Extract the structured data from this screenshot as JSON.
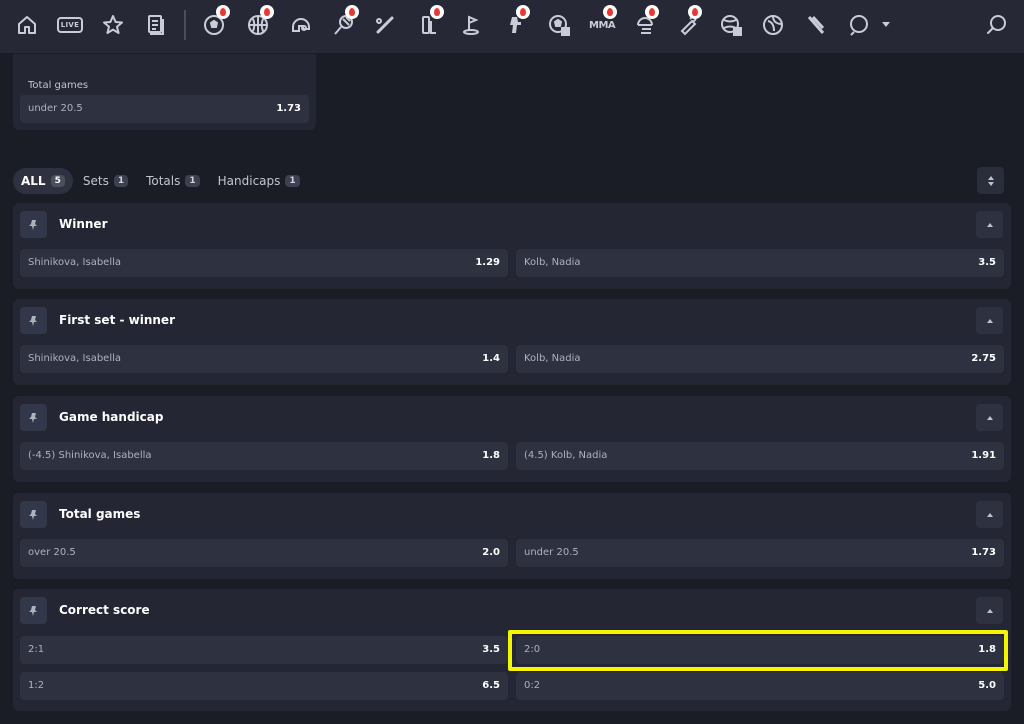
{
  "topbar": {
    "icons": [
      "home-icon",
      "live-icon",
      "star-icon",
      "betslip-icon",
      "soccer-icon",
      "basketball-icon",
      "hockey-icon",
      "tennis-icon",
      "baseball-icon",
      "cricket-icon",
      "golf-icon",
      "esports-icon",
      "futsal-icon",
      "mma-icon",
      "table-tennis-icon",
      "boxing-icon",
      "handball-icon",
      "rugby-icon",
      "badminton-icon",
      "volleyball-icon",
      "search-icon"
    ],
    "live_label": "LIVE",
    "mma_label": "MMA"
  },
  "previous_market": {
    "title": "Total games",
    "odds": [
      {
        "label": "under 20.5",
        "value": "1.73"
      }
    ]
  },
  "filter_tabs": [
    {
      "label": "ALL",
      "count": "5"
    },
    {
      "label": "Sets",
      "count": "1"
    },
    {
      "label": "Totals",
      "count": "1"
    },
    {
      "label": "Handicaps",
      "count": "1"
    }
  ],
  "markets": [
    {
      "title": "Winner",
      "odds": [
        {
          "label": "Shinikova, Isabella",
          "value": "1.29"
        },
        {
          "label": "Kolb, Nadia",
          "value": "3.5"
        }
      ]
    },
    {
      "title": "First set - winner",
      "odds": [
        {
          "label": "Shinikova, Isabella",
          "value": "1.4"
        },
        {
          "label": "Kolb, Nadia",
          "value": "2.75"
        }
      ]
    },
    {
      "title": "Game handicap",
      "odds": [
        {
          "label": "(-4.5) Shinikova, Isabella",
          "value": "1.8"
        },
        {
          "label": "(4.5) Kolb, Nadia",
          "value": "1.91"
        }
      ]
    },
    {
      "title": "Total games",
      "odds": [
        {
          "label": "over 20.5",
          "value": "2.0"
        },
        {
          "label": "under 20.5",
          "value": "1.73"
        }
      ]
    },
    {
      "title": "Correct score",
      "odds": [
        {
          "label": "2:1",
          "value": "3.5"
        },
        {
          "label": "2:0",
          "value": "1.8"
        },
        {
          "label": "1:2",
          "value": "6.5"
        },
        {
          "label": "0:2",
          "value": "5.0"
        }
      ]
    }
  ],
  "colors": {
    "highlight": "#f5f500",
    "background": "#1b1d26",
    "card": "#242733",
    "odd_button": "#2e3140"
  }
}
